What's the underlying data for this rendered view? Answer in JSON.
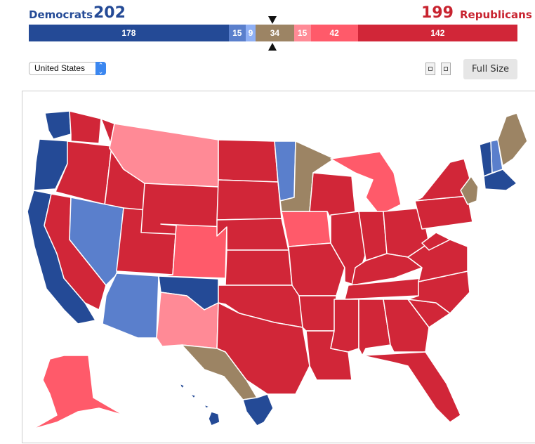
{
  "header": {
    "dem_label": "Democrats",
    "dem_total": "202",
    "rep_total": "199",
    "rep_label": "Republicans"
  },
  "colors": {
    "solid_d": "#244a96",
    "likely_d": "#5a7fcc",
    "lean_d": "#8fb0f5",
    "tossup": "#9c8464",
    "lean_r": "#ff8a96",
    "likely_r": "#ff5a6a",
    "solid_r": "#d12638"
  },
  "balance_bar": {
    "total_seats": 435,
    "segments": [
      {
        "category": "solid_d",
        "label": "178",
        "seats": 178
      },
      {
        "category": "likely_d",
        "label": "15",
        "seats": 15
      },
      {
        "category": "lean_d",
        "label": "9",
        "seats": 9
      },
      {
        "category": "tossup",
        "label": "34",
        "seats": 34
      },
      {
        "category": "lean_r",
        "label": "15",
        "seats": 15
      },
      {
        "category": "likely_r",
        "label": "42",
        "seats": 42
      },
      {
        "category": "solid_r",
        "label": "142",
        "seats": 142
      }
    ]
  },
  "controls": {
    "region_select": "United States",
    "full_size_label": "Full Size"
  },
  "map": {
    "regions": [
      {
        "name": "washington-west",
        "category": "solid_d"
      },
      {
        "name": "washington-east",
        "category": "solid_r"
      },
      {
        "name": "oregon-coast",
        "category": "solid_d"
      },
      {
        "name": "oregon-east",
        "category": "solid_r"
      },
      {
        "name": "california-coast",
        "category": "solid_d"
      },
      {
        "name": "california-inland",
        "category": "solid_r"
      },
      {
        "name": "idaho",
        "category": "solid_r"
      },
      {
        "name": "montana",
        "category": "lean_r"
      },
      {
        "name": "nevada",
        "category": "likely_d"
      },
      {
        "name": "utah",
        "category": "solid_r"
      },
      {
        "name": "arizona",
        "category": "likely_d"
      },
      {
        "name": "wyoming",
        "category": "solid_r"
      },
      {
        "name": "colorado",
        "category": "likely_r"
      },
      {
        "name": "new-mexico-north",
        "category": "solid_d"
      },
      {
        "name": "new-mexico-south",
        "category": "lean_r"
      },
      {
        "name": "north-dakota",
        "category": "solid_r"
      },
      {
        "name": "south-dakota",
        "category": "solid_r"
      },
      {
        "name": "nebraska",
        "category": "solid_r"
      },
      {
        "name": "kansas",
        "category": "solid_r"
      },
      {
        "name": "oklahoma",
        "category": "solid_r"
      },
      {
        "name": "texas",
        "category": "solid_r"
      },
      {
        "name": "texas-west",
        "category": "tossup"
      },
      {
        "name": "texas-south",
        "category": "solid_d"
      },
      {
        "name": "minnesota-west",
        "category": "likely_d"
      },
      {
        "name": "minnesota-east",
        "category": "tossup"
      },
      {
        "name": "iowa",
        "category": "likely_r"
      },
      {
        "name": "missouri",
        "category": "solid_r"
      },
      {
        "name": "arkansas",
        "category": "solid_r"
      },
      {
        "name": "louisiana",
        "category": "solid_r"
      },
      {
        "name": "wisconsin",
        "category": "solid_r"
      },
      {
        "name": "illinois",
        "category": "solid_r"
      },
      {
        "name": "michigan",
        "category": "likely_r"
      },
      {
        "name": "indiana",
        "category": "solid_r"
      },
      {
        "name": "ohio",
        "category": "solid_r"
      },
      {
        "name": "kentucky",
        "category": "solid_r"
      },
      {
        "name": "tennessee",
        "category": "solid_r"
      },
      {
        "name": "mississippi",
        "category": "solid_r"
      },
      {
        "name": "alabama",
        "category": "solid_r"
      },
      {
        "name": "georgia",
        "category": "solid_r"
      },
      {
        "name": "florida",
        "category": "solid_r"
      },
      {
        "name": "south-carolina",
        "category": "solid_r"
      },
      {
        "name": "north-carolina",
        "category": "solid_r"
      },
      {
        "name": "virginia",
        "category": "solid_r"
      },
      {
        "name": "west-virginia",
        "category": "solid_r"
      },
      {
        "name": "pennsylvania",
        "category": "solid_r"
      },
      {
        "name": "new-york",
        "category": "solid_r"
      },
      {
        "name": "new-york-east",
        "category": "tossup"
      },
      {
        "name": "vermont",
        "category": "solid_d"
      },
      {
        "name": "new-hampshire",
        "category": "likely_d"
      },
      {
        "name": "maine",
        "category": "tossup"
      },
      {
        "name": "massachusetts",
        "category": "solid_d"
      },
      {
        "name": "alaska",
        "category": "likely_r"
      },
      {
        "name": "hawaii",
        "category": "solid_d"
      }
    ]
  }
}
